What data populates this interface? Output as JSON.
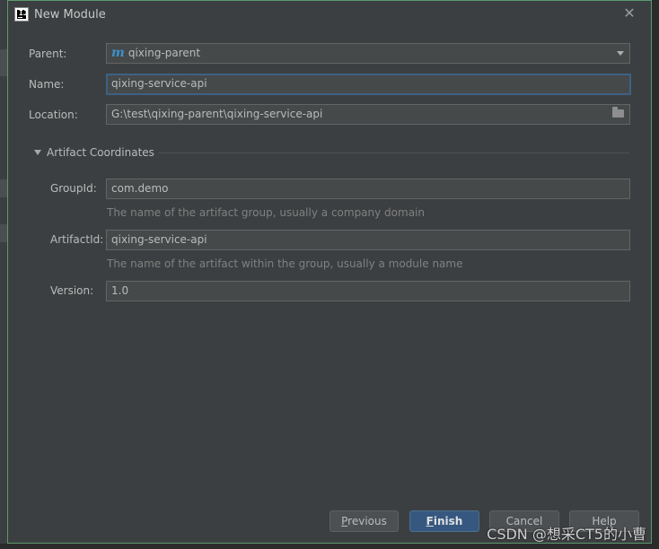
{
  "window": {
    "title": "New Module",
    "app_icon": "intellij-icon"
  },
  "form": {
    "parent_label": "Parent:",
    "parent_value": "qixing-parent",
    "parent_icon_glyph": "m",
    "name_label": "Name:",
    "name_value": "qixing-service-api",
    "location_label": "Location:",
    "location_value": "G:\\test\\qixing-parent\\qixing-service-api"
  },
  "artifact": {
    "section_title": "Artifact Coordinates",
    "groupid_label": "GroupId:",
    "groupid_value": "com.demo",
    "groupid_hint": "The name of the artifact group, usually a company domain",
    "artifactid_label": "ArtifactId:",
    "artifactid_value": "qixing-service-api",
    "artifactid_hint": "The name of the artifact within the group, usually a module name",
    "version_label": "Version:",
    "version_value": "1.0"
  },
  "buttons": {
    "previous_mnemonic": "P",
    "previous_rest": "revious",
    "finish_mnemonic": "F",
    "finish_rest": "inish",
    "cancel": "Cancel",
    "help": "Help"
  },
  "watermark": "CSDN @想采CT5的小曹",
  "colors": {
    "dialog_bg": "#3c3f41",
    "field_bg": "#45494a",
    "focus_border": "#3d6185",
    "primary_button": "#365880",
    "maven_icon": "#3f8fc9"
  }
}
